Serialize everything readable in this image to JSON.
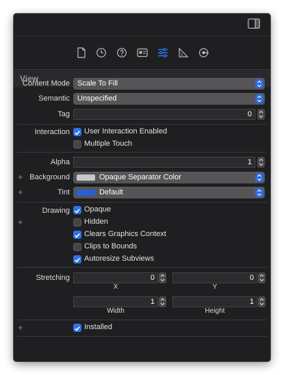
{
  "section_title": "View",
  "content_mode": {
    "label": "Content Mode",
    "value": "Scale To Fill"
  },
  "semantic": {
    "label": "Semantic",
    "value": "Unspecified"
  },
  "tag": {
    "label": "Tag",
    "value": "0"
  },
  "interaction": {
    "label": "Interaction",
    "options": [
      {
        "label": "User Interaction Enabled",
        "checked": true
      },
      {
        "label": "Multiple Touch",
        "checked": false
      }
    ]
  },
  "alpha": {
    "label": "Alpha",
    "value": "1"
  },
  "background": {
    "label": "Background",
    "value": "Opaque Separator Color",
    "swatch": "#c8c8cc"
  },
  "tint": {
    "label": "Tint",
    "value": "Default",
    "swatch": "#2a5fd6"
  },
  "drawing": {
    "label": "Drawing",
    "options": [
      {
        "label": "Opaque",
        "checked": true
      },
      {
        "label": "Hidden",
        "checked": false
      },
      {
        "label": "Clears Graphics Context",
        "checked": true
      },
      {
        "label": "Clips to Bounds",
        "checked": false
      },
      {
        "label": "Autoresize Subviews",
        "checked": true
      }
    ]
  },
  "stretching": {
    "label": "Stretching",
    "x": {
      "value": "0",
      "label": "X"
    },
    "y": {
      "value": "0",
      "label": "Y"
    },
    "width": {
      "value": "1",
      "label": "Width"
    },
    "height": {
      "value": "1",
      "label": "Height"
    }
  },
  "installed": {
    "label": "Installed",
    "checked": true
  },
  "plus_glyph": "+",
  "tabs": [
    {
      "icon": "file-inspector-icon",
      "selected": false
    },
    {
      "icon": "history-icon",
      "selected": false
    },
    {
      "icon": "quick-help-icon",
      "selected": false
    },
    {
      "icon": "identity-inspector-icon",
      "selected": false
    },
    {
      "icon": "attributes-inspector-icon",
      "selected": true
    },
    {
      "icon": "size-inspector-icon",
      "selected": false
    },
    {
      "icon": "connections-inspector-icon",
      "selected": false
    }
  ],
  "colors": {
    "accent": "#2f74e6",
    "panel": "#1f1f21"
  }
}
